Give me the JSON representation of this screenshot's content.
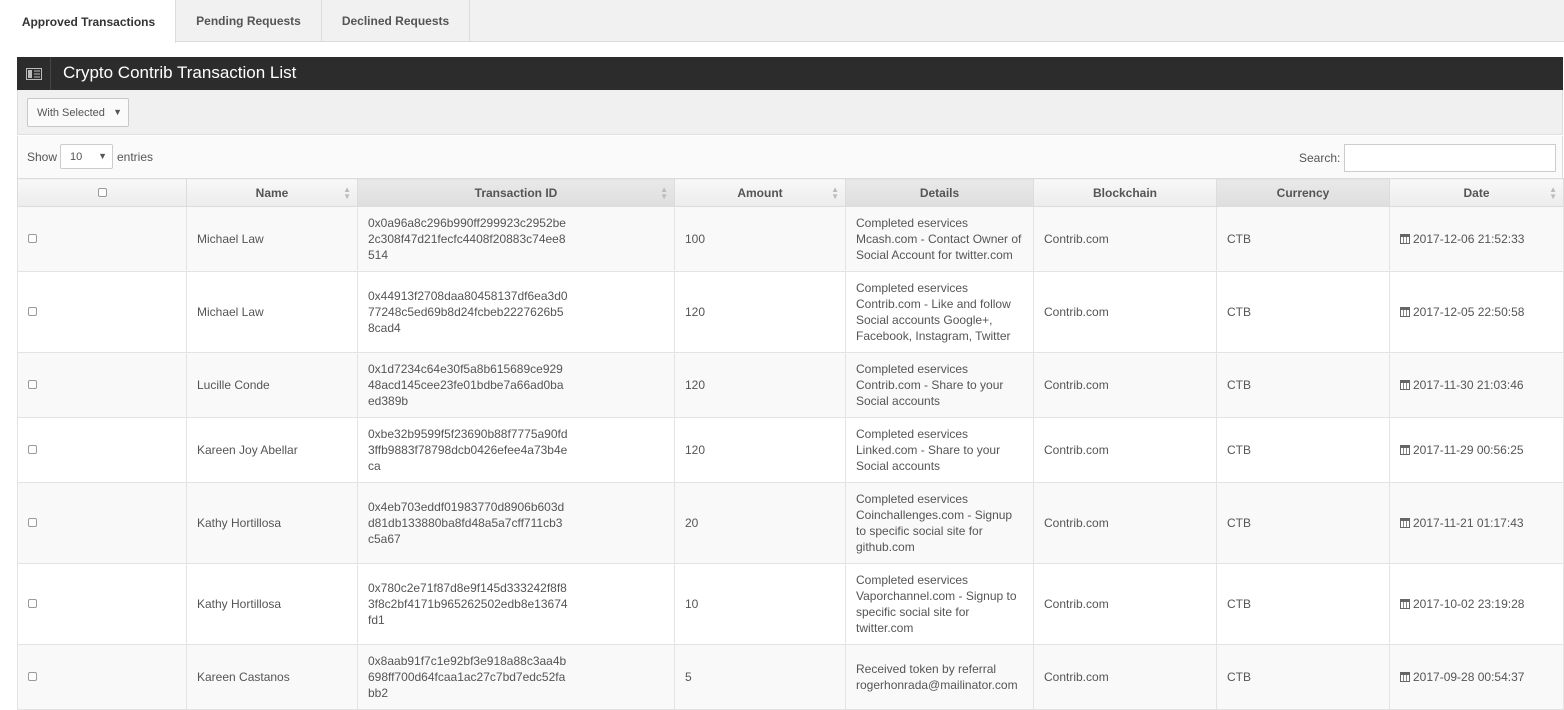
{
  "tabs": [
    {
      "label": "Approved Transactions",
      "active": true
    },
    {
      "label": "Pending Requests",
      "active": false
    },
    {
      "label": "Declined Requests",
      "active": false
    }
  ],
  "panel": {
    "title": "Crypto Contrib Transaction List",
    "icon": "table-list-icon"
  },
  "toolbar": {
    "bulk_action_label": "With Selected"
  },
  "controls": {
    "show_label": "Show",
    "page_length": "10",
    "entries_label": "entries",
    "search_label": "Search:",
    "search_value": ""
  },
  "table": {
    "columns": [
      "",
      "Name",
      "Transaction ID",
      "Amount",
      "Details",
      "Blockchain",
      "Currency",
      "Date"
    ],
    "rows": [
      {
        "name": "Michael Law",
        "txid": "0x0a96a8c296b990ff299923c2952be2c308f47d21fecfc4408f20883c74ee8514",
        "amount": "100",
        "details": "Completed eservices Mcash.com - Contact Owner of Social Account for twitter.com",
        "blockchain": "Contrib.com",
        "currency": "CTB",
        "date": "2017-12-06 21:52:33"
      },
      {
        "name": "Michael Law",
        "txid": "0x44913f2708daa80458137df6ea3d077248c5ed69b8d24fcbeb2227626b58cad4",
        "amount": "120",
        "details": "Completed eservices Contrib.com - Like and follow Social accounts Google+, Facebook, Instagram, Twitter",
        "blockchain": "Contrib.com",
        "currency": "CTB",
        "date": "2017-12-05 22:50:58"
      },
      {
        "name": "Lucille Conde",
        "txid": "0x1d7234c64e30f5a8b615689ce92948acd145cee23fe01bdbe7a66ad0baed389b",
        "amount": "120",
        "details": "Completed eservices Contrib.com - Share to your Social accounts",
        "blockchain": "Contrib.com",
        "currency": "CTB",
        "date": "2017-11-30 21:03:46"
      },
      {
        "name": "Kareen Joy Abellar",
        "txid": "0xbe32b9599f5f23690b88f7775a90fd3ffb9883f78798dcb0426efee4a73b4eca",
        "amount": "120",
        "details": "Completed eservices Linked.com - Share to your Social accounts",
        "blockchain": "Contrib.com",
        "currency": "CTB",
        "date": "2017-11-29 00:56:25"
      },
      {
        "name": "Kathy Hortillosa",
        "txid": "0x4eb703eddf01983770d8906b603dd81db133880ba8fd48a5a7cff711cb3c5a67",
        "amount": "20",
        "details": "Completed eservices Coinchallenges.com - Signup to specific social site for github.com",
        "blockchain": "Contrib.com",
        "currency": "CTB",
        "date": "2017-11-21 01:17:43"
      },
      {
        "name": "Kathy Hortillosa",
        "txid": "0x780c2e71f87d8e9f145d333242f8f83f8c2bf4171b965262502edb8e13674fd1",
        "amount": "10",
        "details": "Completed eservices Vaporchannel.com - Signup to specific social site for twitter.com",
        "blockchain": "Contrib.com",
        "currency": "CTB",
        "date": "2017-10-02 23:19:28"
      },
      {
        "name": "Kareen Castanos",
        "txid": "0x8aab91f7c1e92bf3e918a88c3aa4b698ff700d64fcaa1ac27c7bd7edc52fabb2",
        "amount": "5",
        "details": "Received token by referral rogerhonrada@mailinator.com",
        "blockchain": "Contrib.com",
        "currency": "CTB",
        "date": "2017-09-28 00:54:37"
      }
    ]
  }
}
